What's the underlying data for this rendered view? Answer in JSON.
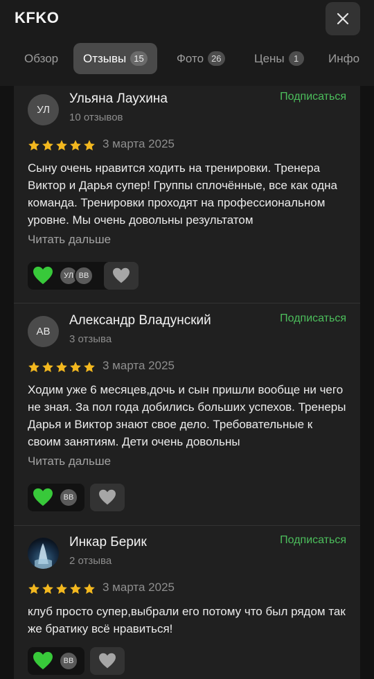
{
  "header": {
    "title": "KFKO",
    "close_icon": "close-icon",
    "tabs": [
      {
        "label": "Обзор",
        "count": null
      },
      {
        "label": "Отзывы",
        "count": "15",
        "active": true
      },
      {
        "label": "Фото",
        "count": "26"
      },
      {
        "label": "Цены",
        "count": "1"
      },
      {
        "label": "Инфо",
        "count": null
      }
    ]
  },
  "colors": {
    "accent_green": "#4cbf5c",
    "star_gold": "#f3b81f",
    "heart_green": "#38c93a"
  },
  "reviews": [
    {
      "initials": "УЛ",
      "author": "Ульяна Лаухина",
      "reviews_count": "10 отзывов",
      "subscribe": "Подписаться",
      "rating": 5,
      "date": "3 марта 2025",
      "text": "Сыну очень нравится ходить на тренировки. Тренера Виктор и Дарья супер! Группы сплочённые, все как одна команда. Тренировки проходят на профессиональном уровне. Мы очень довольны результатом",
      "read_more": "Читать дальше",
      "reactors": [
        "УЛ",
        "ВВ"
      ]
    },
    {
      "initials": "АВ",
      "author": "Александр Владунский",
      "reviews_count": "3 отзыва",
      "subscribe": "Подписаться",
      "rating": 5,
      "date": "3 марта 2025",
      "text": "Ходим уже 6 месяцев,дочь и сын пришли вообще ни чего не зная. За пол года добились больших успехов. Тренеры Дарья и Виктор знают свое дело. Требовательные к своим занятиям. Дети очень довольны",
      "read_more": "Читать дальше",
      "reactors": [
        "ВВ"
      ]
    },
    {
      "initials": "",
      "author": "Инкар Берик",
      "reviews_count": "2 отзыва",
      "subscribe": "Подписаться",
      "rating": 5,
      "date": "3 марта 2025",
      "text": "клуб просто супер,выбрали его потому что был рядом так же братику всё нравиться!",
      "read_more": "",
      "reactors": [
        "ВВ"
      ]
    }
  ]
}
